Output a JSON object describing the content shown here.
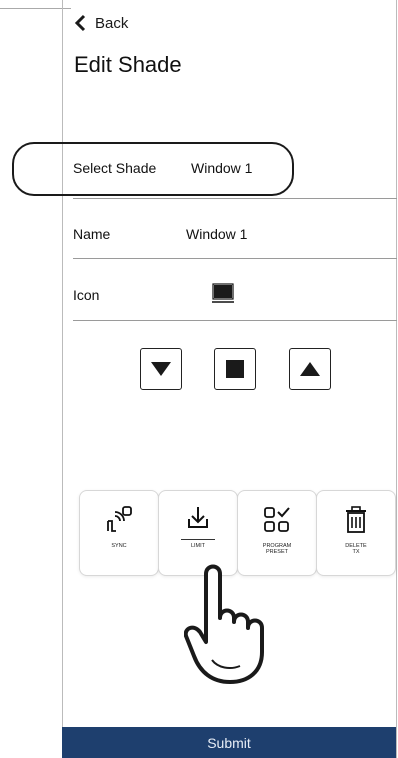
{
  "nav": {
    "back_label": "Back"
  },
  "page": {
    "title": "Edit Shade"
  },
  "select_shade": {
    "label": "Select Shade",
    "value": "Window 1"
  },
  "name_row": {
    "label": "Name",
    "value": "Window 1"
  },
  "icon_row": {
    "label": "Icon",
    "icon": "window-shade-icon"
  },
  "controls": [
    {
      "name": "down",
      "icon": "triangle-down-icon"
    },
    {
      "name": "stop",
      "icon": "square-stop-icon"
    },
    {
      "name": "up",
      "icon": "triangle-up-icon"
    }
  ],
  "actions": [
    {
      "label": "SYNC",
      "icon": "sync-icon"
    },
    {
      "label": "LIMIT",
      "icon": "limit-icon"
    },
    {
      "label": "PROGRAM PRESET",
      "label_line1": "PROGRAM",
      "label_line2": "PRESET",
      "icon": "program-preset-icon"
    },
    {
      "label": "DELETE TX",
      "label_line1": "DELETE",
      "label_line2": "TX",
      "icon": "trash-icon"
    }
  ],
  "submit": {
    "label": "Submit"
  },
  "colors": {
    "submit_bar": "#1e3f6e",
    "divider": "#9a9a9a",
    "outline": "#1a1a1a"
  }
}
